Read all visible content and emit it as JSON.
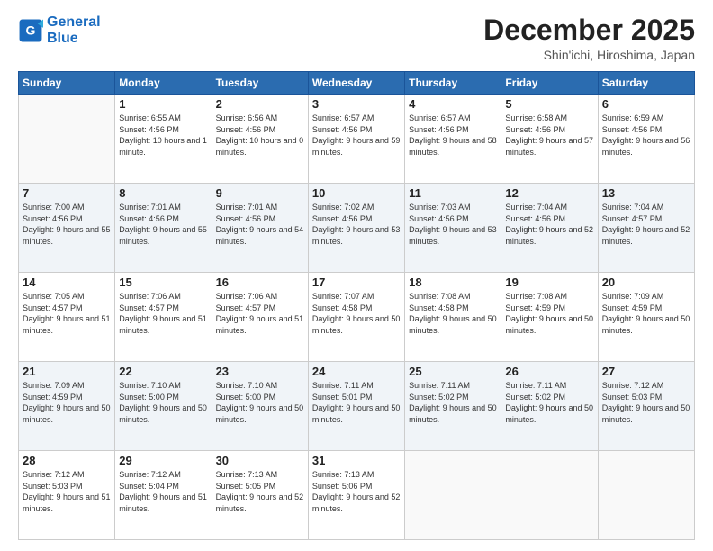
{
  "header": {
    "logo_line1": "General",
    "logo_line2": "Blue",
    "month": "December 2025",
    "location": "Shin'ichi, Hiroshima, Japan"
  },
  "weekdays": [
    "Sunday",
    "Monday",
    "Tuesday",
    "Wednesday",
    "Thursday",
    "Friday",
    "Saturday"
  ],
  "weeks": [
    [
      {
        "day": "",
        "sunrise": "",
        "sunset": "",
        "daylight": ""
      },
      {
        "day": "1",
        "sunrise": "Sunrise: 6:55 AM",
        "sunset": "Sunset: 4:56 PM",
        "daylight": "Daylight: 10 hours and 1 minute."
      },
      {
        "day": "2",
        "sunrise": "Sunrise: 6:56 AM",
        "sunset": "Sunset: 4:56 PM",
        "daylight": "Daylight: 10 hours and 0 minutes."
      },
      {
        "day": "3",
        "sunrise": "Sunrise: 6:57 AM",
        "sunset": "Sunset: 4:56 PM",
        "daylight": "Daylight: 9 hours and 59 minutes."
      },
      {
        "day": "4",
        "sunrise": "Sunrise: 6:57 AM",
        "sunset": "Sunset: 4:56 PM",
        "daylight": "Daylight: 9 hours and 58 minutes."
      },
      {
        "day": "5",
        "sunrise": "Sunrise: 6:58 AM",
        "sunset": "Sunset: 4:56 PM",
        "daylight": "Daylight: 9 hours and 57 minutes."
      },
      {
        "day": "6",
        "sunrise": "Sunrise: 6:59 AM",
        "sunset": "Sunset: 4:56 PM",
        "daylight": "Daylight: 9 hours and 56 minutes."
      }
    ],
    [
      {
        "day": "7",
        "sunrise": "Sunrise: 7:00 AM",
        "sunset": "Sunset: 4:56 PM",
        "daylight": "Daylight: 9 hours and 55 minutes."
      },
      {
        "day": "8",
        "sunrise": "Sunrise: 7:01 AM",
        "sunset": "Sunset: 4:56 PM",
        "daylight": "Daylight: 9 hours and 55 minutes."
      },
      {
        "day": "9",
        "sunrise": "Sunrise: 7:01 AM",
        "sunset": "Sunset: 4:56 PM",
        "daylight": "Daylight: 9 hours and 54 minutes."
      },
      {
        "day": "10",
        "sunrise": "Sunrise: 7:02 AM",
        "sunset": "Sunset: 4:56 PM",
        "daylight": "Daylight: 9 hours and 53 minutes."
      },
      {
        "day": "11",
        "sunrise": "Sunrise: 7:03 AM",
        "sunset": "Sunset: 4:56 PM",
        "daylight": "Daylight: 9 hours and 53 minutes."
      },
      {
        "day": "12",
        "sunrise": "Sunrise: 7:04 AM",
        "sunset": "Sunset: 4:56 PM",
        "daylight": "Daylight: 9 hours and 52 minutes."
      },
      {
        "day": "13",
        "sunrise": "Sunrise: 7:04 AM",
        "sunset": "Sunset: 4:57 PM",
        "daylight": "Daylight: 9 hours and 52 minutes."
      }
    ],
    [
      {
        "day": "14",
        "sunrise": "Sunrise: 7:05 AM",
        "sunset": "Sunset: 4:57 PM",
        "daylight": "Daylight: 9 hours and 51 minutes."
      },
      {
        "day": "15",
        "sunrise": "Sunrise: 7:06 AM",
        "sunset": "Sunset: 4:57 PM",
        "daylight": "Daylight: 9 hours and 51 minutes."
      },
      {
        "day": "16",
        "sunrise": "Sunrise: 7:06 AM",
        "sunset": "Sunset: 4:57 PM",
        "daylight": "Daylight: 9 hours and 51 minutes."
      },
      {
        "day": "17",
        "sunrise": "Sunrise: 7:07 AM",
        "sunset": "Sunset: 4:58 PM",
        "daylight": "Daylight: 9 hours and 50 minutes."
      },
      {
        "day": "18",
        "sunrise": "Sunrise: 7:08 AM",
        "sunset": "Sunset: 4:58 PM",
        "daylight": "Daylight: 9 hours and 50 minutes."
      },
      {
        "day": "19",
        "sunrise": "Sunrise: 7:08 AM",
        "sunset": "Sunset: 4:59 PM",
        "daylight": "Daylight: 9 hours and 50 minutes."
      },
      {
        "day": "20",
        "sunrise": "Sunrise: 7:09 AM",
        "sunset": "Sunset: 4:59 PM",
        "daylight": "Daylight: 9 hours and 50 minutes."
      }
    ],
    [
      {
        "day": "21",
        "sunrise": "Sunrise: 7:09 AM",
        "sunset": "Sunset: 4:59 PM",
        "daylight": "Daylight: 9 hours and 50 minutes."
      },
      {
        "day": "22",
        "sunrise": "Sunrise: 7:10 AM",
        "sunset": "Sunset: 5:00 PM",
        "daylight": "Daylight: 9 hours and 50 minutes."
      },
      {
        "day": "23",
        "sunrise": "Sunrise: 7:10 AM",
        "sunset": "Sunset: 5:00 PM",
        "daylight": "Daylight: 9 hours and 50 minutes."
      },
      {
        "day": "24",
        "sunrise": "Sunrise: 7:11 AM",
        "sunset": "Sunset: 5:01 PM",
        "daylight": "Daylight: 9 hours and 50 minutes."
      },
      {
        "day": "25",
        "sunrise": "Sunrise: 7:11 AM",
        "sunset": "Sunset: 5:02 PM",
        "daylight": "Daylight: 9 hours and 50 minutes."
      },
      {
        "day": "26",
        "sunrise": "Sunrise: 7:11 AM",
        "sunset": "Sunset: 5:02 PM",
        "daylight": "Daylight: 9 hours and 50 minutes."
      },
      {
        "day": "27",
        "sunrise": "Sunrise: 7:12 AM",
        "sunset": "Sunset: 5:03 PM",
        "daylight": "Daylight: 9 hours and 50 minutes."
      }
    ],
    [
      {
        "day": "28",
        "sunrise": "Sunrise: 7:12 AM",
        "sunset": "Sunset: 5:03 PM",
        "daylight": "Daylight: 9 hours and 51 minutes."
      },
      {
        "day": "29",
        "sunrise": "Sunrise: 7:12 AM",
        "sunset": "Sunset: 5:04 PM",
        "daylight": "Daylight: 9 hours and 51 minutes."
      },
      {
        "day": "30",
        "sunrise": "Sunrise: 7:13 AM",
        "sunset": "Sunset: 5:05 PM",
        "daylight": "Daylight: 9 hours and 52 minutes."
      },
      {
        "day": "31",
        "sunrise": "Sunrise: 7:13 AM",
        "sunset": "Sunset: 5:06 PM",
        "daylight": "Daylight: 9 hours and 52 minutes."
      },
      {
        "day": "",
        "sunrise": "",
        "sunset": "",
        "daylight": ""
      },
      {
        "day": "",
        "sunrise": "",
        "sunset": "",
        "daylight": ""
      },
      {
        "day": "",
        "sunrise": "",
        "sunset": "",
        "daylight": ""
      }
    ]
  ]
}
